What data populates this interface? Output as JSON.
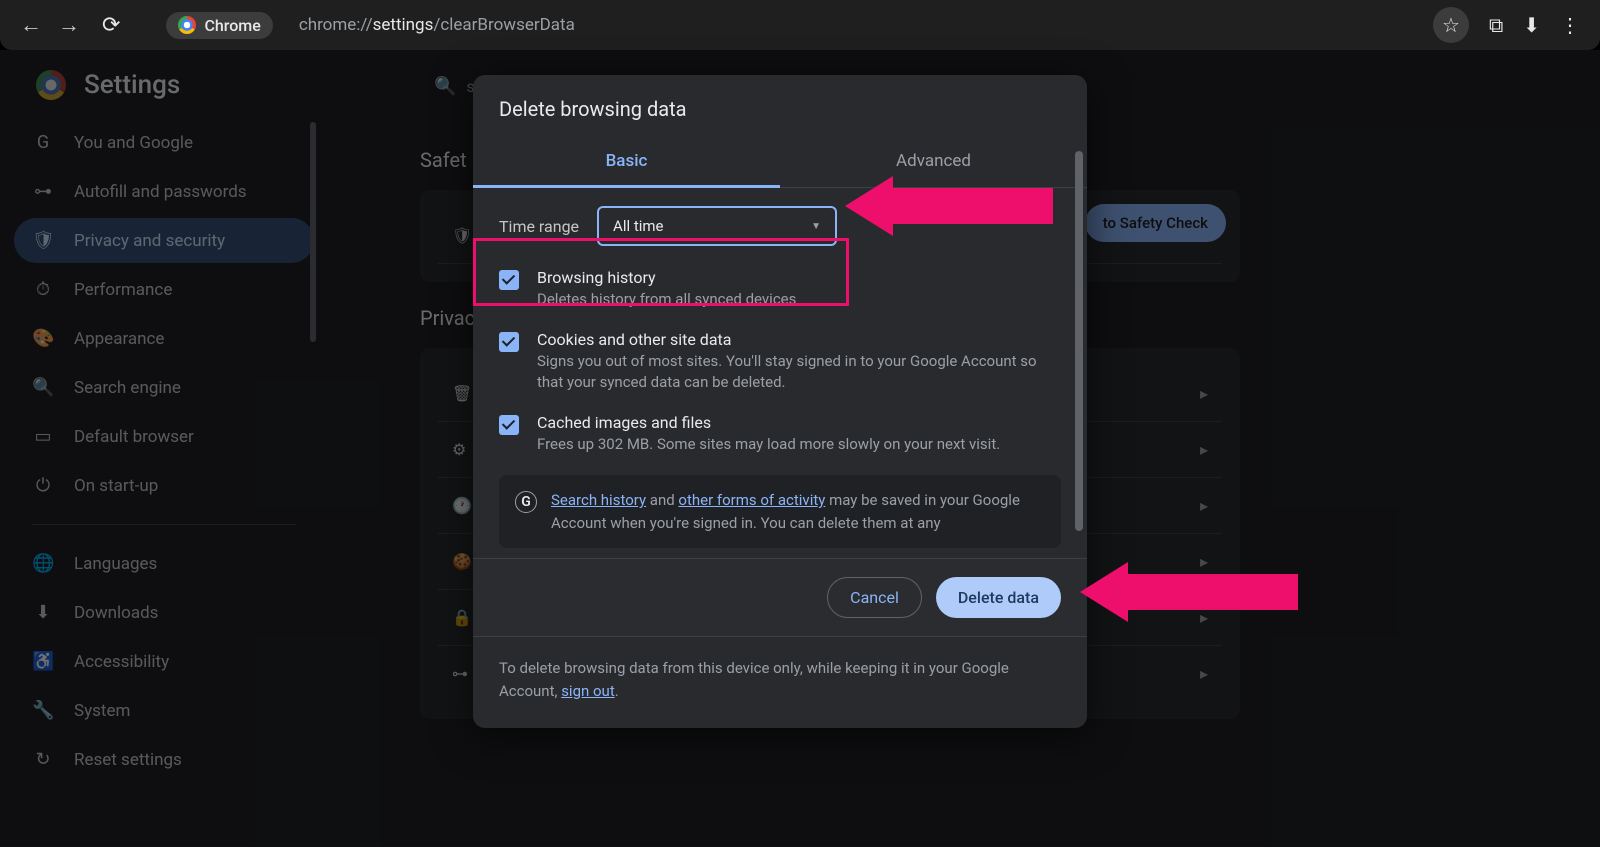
{
  "toolbar": {
    "chip_label": "Chrome",
    "url_prefix": "chrome://",
    "url_bold": "settings",
    "url_suffix": "/clearBrowserData"
  },
  "settings": {
    "title": "Settings",
    "search_placeholder": "s"
  },
  "sidebar": [
    {
      "icon": "G",
      "label": "You and Google"
    },
    {
      "icon": "⊶",
      "label": "Autofill and passwords"
    },
    {
      "icon": "🛡",
      "label": "Privacy and security",
      "active": true
    },
    {
      "icon": "⏱",
      "label": "Performance"
    },
    {
      "icon": "🎨",
      "label": "Appearance"
    },
    {
      "icon": "🔍",
      "label": "Search engine"
    },
    {
      "icon": "▭",
      "label": "Default browser"
    },
    {
      "icon": "⏻",
      "label": "On start-up"
    }
  ],
  "sidebar2": [
    {
      "icon": "🌐",
      "label": "Languages"
    },
    {
      "icon": "⬇",
      "label": "Downloads"
    },
    {
      "icon": "♿",
      "label": "Accessibility"
    },
    {
      "icon": "🔧",
      "label": "System"
    },
    {
      "icon": "↻",
      "label": "Reset settings"
    }
  ],
  "bg": {
    "safety_heading": "Safet",
    "safety_btn": "to Safety Check",
    "privacy_heading": "Privac"
  },
  "dialog": {
    "title": "Delete browsing data",
    "tabs": {
      "basic": "Basic",
      "advanced": "Advanced"
    },
    "time_label": "Time range",
    "time_value": "All time",
    "items": [
      {
        "title": "Browsing history",
        "desc": "Deletes history from all synced devices"
      },
      {
        "title": "Cookies and other site data",
        "desc": "Signs you out of most sites. You'll stay signed in to your Google Account so that your synced data can be deleted."
      },
      {
        "title": "Cached images and files",
        "desc": "Frees up 302 MB. Some sites may load more slowly on your next visit."
      }
    ],
    "info": {
      "link1": "Search history",
      "mid1": " and ",
      "link2": "other forms of activity",
      "rest": " may be saved in your Google Account when you're signed in. You can delete them at any"
    },
    "cancel": "Cancel",
    "delete": "Delete data",
    "footer": {
      "text": "To delete browsing data from this device only, while keeping it in your Google Account, ",
      "link": "sign out",
      "dot": "."
    }
  }
}
